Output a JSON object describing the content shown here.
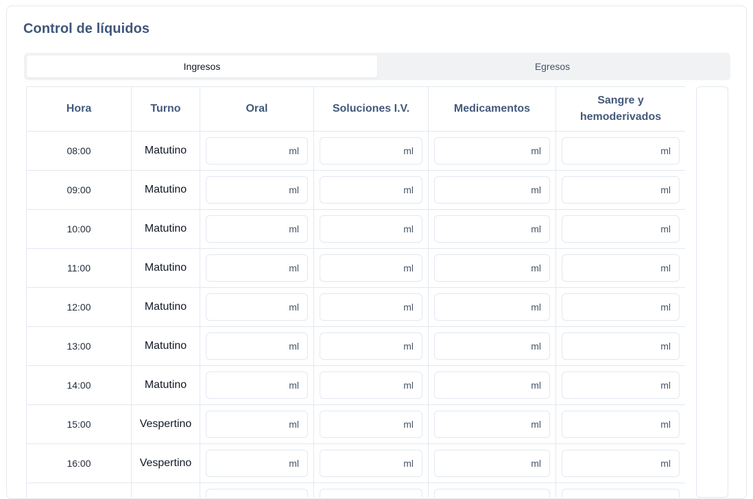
{
  "title": "Control de líquidos",
  "tabs": [
    {
      "label": "Ingresos",
      "active": true
    },
    {
      "label": "Egresos",
      "active": false
    }
  ],
  "table": {
    "headers": [
      "Hora",
      "Turno",
      "Oral",
      "Soluciones I.V.",
      "Medicamentos",
      "Sangre y hemoderivados"
    ],
    "unit": "ml",
    "rows": [
      {
        "hora": "08:00",
        "turno": "Matutino"
      },
      {
        "hora": "09:00",
        "turno": "Matutino"
      },
      {
        "hora": "10:00",
        "turno": "Matutino"
      },
      {
        "hora": "11:00",
        "turno": "Matutino"
      },
      {
        "hora": "12:00",
        "turno": "Matutino"
      },
      {
        "hora": "13:00",
        "turno": "Matutino"
      },
      {
        "hora": "14:00",
        "turno": "Matutino"
      },
      {
        "hora": "15:00",
        "turno": "Vespertino"
      },
      {
        "hora": "16:00",
        "turno": "Vespertino"
      },
      {
        "hora": "",
        "turno": ""
      }
    ]
  }
}
